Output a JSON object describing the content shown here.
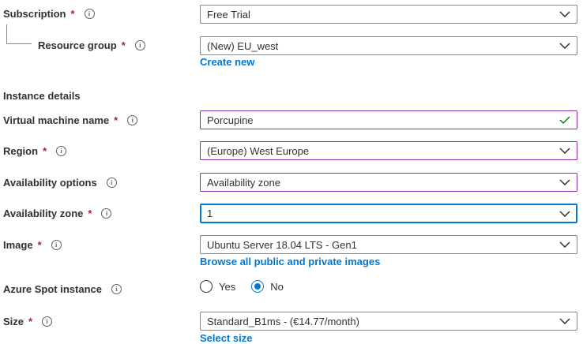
{
  "subscription": {
    "label": "Subscription",
    "required": "*",
    "info": "i",
    "value": "Free Trial"
  },
  "resource_group": {
    "label": "Resource group",
    "required": "*",
    "info": "i",
    "value": "(New) EU_west",
    "create_link": "Create new"
  },
  "instance_details": {
    "title": "Instance details"
  },
  "vm_name": {
    "label": "Virtual machine name",
    "required": "*",
    "info": "i",
    "value": "Porcupine"
  },
  "region": {
    "label": "Region",
    "required": "*",
    "info": "i",
    "value": "(Europe) West Europe"
  },
  "availability_options": {
    "label": "Availability options",
    "info": "i",
    "value": "Availability zone"
  },
  "availability_zone": {
    "label": "Availability zone",
    "required": "*",
    "info": "i",
    "value": "1"
  },
  "image": {
    "label": "Image",
    "required": "*",
    "info": "i",
    "value": "Ubuntu Server 18.04 LTS - Gen1",
    "browse_link": "Browse all public and private images"
  },
  "spot": {
    "label": "Azure Spot instance",
    "info": "i",
    "options": [
      {
        "label": "Yes",
        "selected": false
      },
      {
        "label": "No",
        "selected": true
      }
    ]
  },
  "size": {
    "label": "Size",
    "required": "*",
    "info": "i",
    "value": "Standard_B1ms - (€14.77/month)",
    "select_link": "Select size"
  },
  "colors": {
    "link": "#0078d4",
    "required": "#a4262c",
    "valid_check": "#107c10",
    "focus_border": "#0078d4",
    "edited_border": "#8a2da5"
  }
}
